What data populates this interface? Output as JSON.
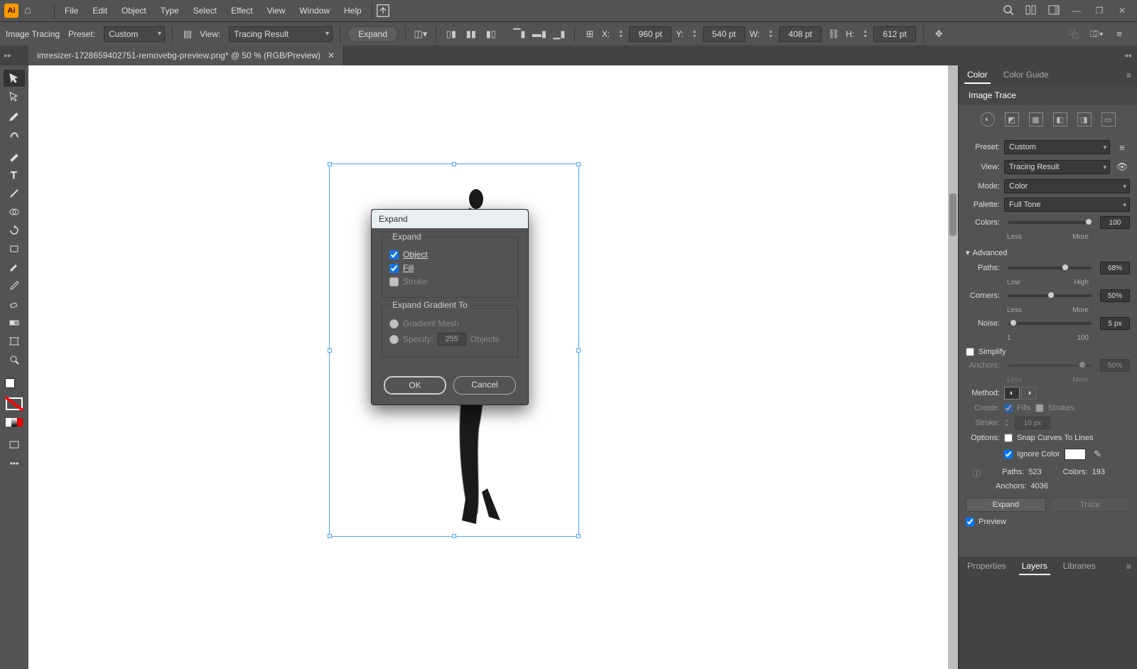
{
  "menubar": {
    "items": [
      "File",
      "Edit",
      "Object",
      "Type",
      "Select",
      "Effect",
      "View",
      "Window",
      "Help"
    ]
  },
  "controlbar": {
    "mode": "Image Tracing",
    "preset_label": "Preset:",
    "preset_value": "Custom",
    "view_label": "View:",
    "view_value": "Tracing Result",
    "expand_btn": "Expand",
    "x_label": "X:",
    "x_value": "960 pt",
    "y_label": "Y:",
    "y_value": "540 pt",
    "w_label": "W:",
    "w_value": "408 pt",
    "h_label": "H:",
    "h_value": "612 pt"
  },
  "tab": {
    "title": "imresizer-1728659402751-removebg-preview.png* @ 50 % (RGB/Preview)"
  },
  "right": {
    "color_tab": "Color",
    "color_guide_tab": "Color Guide",
    "image_trace_tab": "Image Trace",
    "preset_label": "Preset:",
    "preset_value": "Custom",
    "view_label": "View:",
    "view_value": "Tracing Result",
    "mode_label": "Mode:",
    "mode_value": "Color",
    "palette_label": "Palette:",
    "palette_value": "Full Tone",
    "colors_label": "Colors:",
    "colors_value": "100",
    "colors_less": "Less",
    "colors_more": "More",
    "advanced": "Advanced",
    "paths_label": "Paths:",
    "paths_value": "68%",
    "paths_low": "Low",
    "paths_high": "High",
    "corners_label": "Corners:",
    "corners_value": "50%",
    "corners_less": "Less",
    "corners_more": "More",
    "noise_label": "Noise:",
    "noise_value": "5 px",
    "noise_min": "1",
    "noise_max": "100",
    "simplify": "Simplify",
    "anchors_label_slider": "Anchors:",
    "anchors_value_slider": "50%",
    "anchors_less": "Less",
    "anchors_more": "More",
    "method_label": "Method:",
    "create_label": "Create:",
    "create_fills": "Fills",
    "create_strokes": "Strokes",
    "stroke_label": "Stroke:",
    "stroke_value": "10 px",
    "options_label": "Options:",
    "snap_curves": "Snap Curves To Lines",
    "ignore_color": "Ignore Color",
    "paths_stat_label": "Paths:",
    "paths_stat": "523",
    "colors_stat_label": "Colors:",
    "colors_stat": "193",
    "anchors_stat_label": "Anchors:",
    "anchors_stat": "4036",
    "expand_btn": "Expand",
    "trace_btn": "Trace",
    "preview": "Preview",
    "bottom_tabs": {
      "properties": "Properties",
      "layers": "Layers",
      "libraries": "Libraries"
    }
  },
  "dialog": {
    "title": "Expand",
    "section_expand": "Expand",
    "opt_object": "Object",
    "opt_fill": "Fill",
    "opt_stroke": "Stroke",
    "section_gradient": "Expand Gradient To",
    "opt_mesh": "Gradient Mesh",
    "opt_specify": "Specify:",
    "specify_value": "255",
    "specify_unit": "Objects",
    "ok": "OK",
    "cancel": "Cancel"
  }
}
